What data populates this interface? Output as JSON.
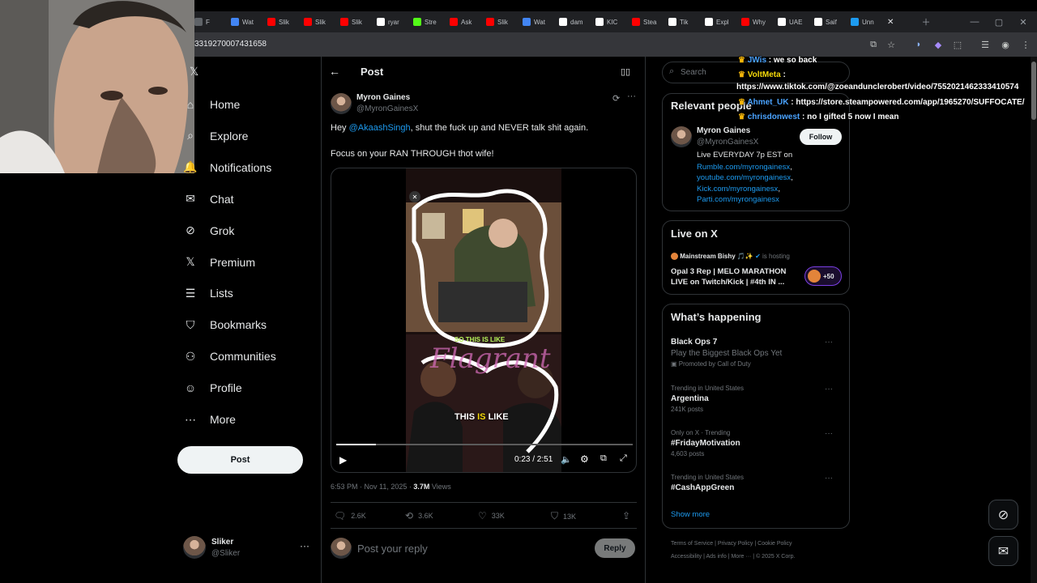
{
  "browser": {
    "tabs": [
      {
        "label": "F",
        "color": "#5f6368"
      },
      {
        "label": "Wat",
        "color": "#4285f4"
      },
      {
        "label": "Slik",
        "color": "#ff0000"
      },
      {
        "label": "Slik",
        "color": "#ff0000"
      },
      {
        "label": "Slik",
        "color": "#ff0000"
      },
      {
        "label": "ryar",
        "color": "#ffffff"
      },
      {
        "label": "Stre",
        "color": "#53fc18"
      },
      {
        "label": "Ask",
        "color": "#ff0000"
      },
      {
        "label": "Slik",
        "color": "#ff0000"
      },
      {
        "label": "Wat",
        "color": "#4285f4"
      },
      {
        "label": "dam",
        "color": "#ffffff"
      },
      {
        "label": "KIC",
        "color": "#ffffff"
      },
      {
        "label": "Stea",
        "color": "#ff0000"
      },
      {
        "label": "Tik",
        "color": "#ffffff"
      },
      {
        "label": "Expl",
        "color": "#ffffff"
      },
      {
        "label": "Why",
        "color": "#ff0000"
      },
      {
        "label": "UAE",
        "color": "#ffffff"
      },
      {
        "label": "Saif",
        "color": "#ffffff"
      },
      {
        "label": "Unn",
        "color": "#1d9bf0"
      }
    ],
    "url": "3319270007431658"
  },
  "sidebar": {
    "items": [
      {
        "label": "Home",
        "icon": "home-icon",
        "glyph": "⌂"
      },
      {
        "label": "Explore",
        "icon": "search-icon",
        "glyph": "⌕"
      },
      {
        "label": "Notifications",
        "icon": "bell-icon",
        "glyph": "🔔"
      },
      {
        "label": "Chat",
        "icon": "mail-icon",
        "glyph": "✉"
      },
      {
        "label": "Grok",
        "icon": "grok-icon",
        "glyph": "⊘"
      },
      {
        "label": "Premium",
        "icon": "x-logo-icon",
        "glyph": "𝕏"
      },
      {
        "label": "Lists",
        "icon": "list-icon",
        "glyph": "☰"
      },
      {
        "label": "Bookmarks",
        "icon": "bookmark-icon",
        "glyph": "⛉"
      },
      {
        "label": "Communities",
        "icon": "people-icon",
        "glyph": "⚇"
      },
      {
        "label": "Profile",
        "icon": "person-icon",
        "glyph": "☺"
      },
      {
        "label": "More",
        "icon": "more-circle-icon",
        "glyph": "⋯"
      }
    ],
    "post_button": "Post",
    "account": {
      "name": "Sliker",
      "handle": "@Sliker"
    }
  },
  "post": {
    "header_title": "Post",
    "author_name": "Myron Gaines",
    "author_handle": "@MyronGainesX",
    "text_prefix": "Hey ",
    "mention": "@AkaashSingh",
    "text_suffix": ", shut the fuck up and NEVER talk shit again.",
    "text_line2": "Focus on your RAN THROUGH thot wife!",
    "video": {
      "caption_top": "SO THIS IS LIKE",
      "caption_bottom_1": "THIS ",
      "caption_bottom_hl": "IS",
      "caption_bottom_2": " LIKE",
      "watermark": "Flagrant",
      "time": "0:23 / 2:51",
      "progress": 0.134
    },
    "timestamp": "6:53 PM · Nov 11, 2025 · ",
    "views_count": "3.7M",
    "views_label": " Views",
    "replies": "2.6K",
    "reposts": "3.6K",
    "likes": "33K",
    "bookmarks": "13K",
    "reply_placeholder": "Post your reply",
    "reply_button": "Reply"
  },
  "right": {
    "search_placeholder": "Search",
    "relevant_title": "Relevant people",
    "person_name": "Myron Gaines",
    "person_handle": "@MyronGainesX",
    "follow": "Follow",
    "bio_line1": "Live EVERYDAY 7p EST on",
    "bio_links": [
      "Rumble.com/myrongainesx",
      "youtube.com/myrongainesx",
      "Kick.com/myrongainesx",
      "Parti.com/myrongainesx"
    ],
    "bio_commas": [
      ",",
      ",",
      ",",
      ""
    ],
    "live_title": "Live on X",
    "live_host": "Mainstream Bishy 🎵✨",
    "live_hosting": "is hosting",
    "live_stream_1": "Opal 3 Rep | MELO MARATHON",
    "live_stream_2": "LIVE on Twitch/Kick | #4th IN ...",
    "live_count": "+50",
    "happening_title": "What’s happening",
    "trends": [
      {
        "meta": "",
        "title": "Black Ops 7",
        "sub": "Play the Biggest Black Ops Yet",
        "extra": "Promoted by Call of Duty"
      },
      {
        "meta": "Trending in United States",
        "title": "Argentina",
        "sub": "241K posts",
        "extra": ""
      },
      {
        "meta": "Only on X · Trending",
        "title": "#FridayMotivation",
        "sub": "4,603 posts",
        "extra": ""
      },
      {
        "meta": "Trending in United States",
        "title": "#CashAppGreen",
        "sub": "",
        "extra": ""
      }
    ],
    "show_more": "Show more",
    "footer_1": [
      "Terms of Service",
      "Privacy Policy",
      "Cookie Policy"
    ],
    "footer_2": [
      "Accessibility",
      "Ads info",
      "More ···",
      "© 2025 X Corp."
    ]
  },
  "chat": [
    {
      "user": "JWis",
      "sep": " : ",
      "msg": "we so back",
      "color": "#4aa3ff"
    },
    {
      "user": "VoltMeta",
      "sep": " :",
      "msg": "",
      "color": "#f5d90a"
    },
    {
      "user": "",
      "sep": "",
      "msg": "https://www.tiktok.com/@zoeandunclerobert/video/7552021462333410574",
      "color": "#fff"
    },
    {
      "user": "Ahmet_UK",
      "sep": " : ",
      "msg": "https://store.steampowered.com/app/1965270/SUFFOCATE/",
      "color": "#4aa3ff"
    },
    {
      "user": "chrisdonwest",
      "sep": " : ",
      "msg": "no I gifted 5 now I mean",
      "color": "#4aa3ff"
    }
  ]
}
